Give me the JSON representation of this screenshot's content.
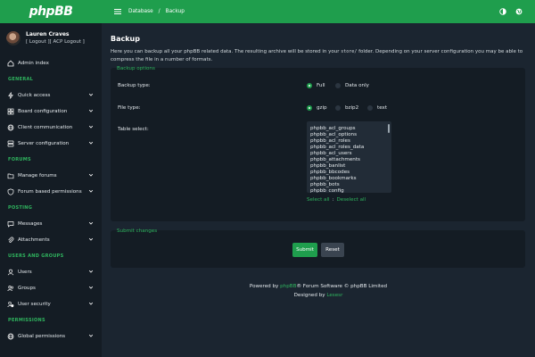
{
  "app": {
    "logo": "phpBB"
  },
  "user": {
    "name": "Lauren Craves",
    "links": "[ Logout ][ ACP Logout ]"
  },
  "sidebar": {
    "items": [
      {
        "type": "item",
        "label": "Admin index",
        "icon": "home-icon",
        "chevron": false
      },
      {
        "type": "section",
        "label": "GENERAL"
      },
      {
        "type": "item",
        "label": "Quick access",
        "icon": "bolt-icon",
        "chevron": true
      },
      {
        "type": "item",
        "label": "Board configuration",
        "icon": "grid-icon",
        "chevron": true
      },
      {
        "type": "item",
        "label": "Client communication",
        "icon": "globe-icon",
        "chevron": true
      },
      {
        "type": "item",
        "label": "Server configuration",
        "icon": "server-icon",
        "chevron": true
      },
      {
        "type": "section",
        "label": "FORUMS"
      },
      {
        "type": "item",
        "label": "Manage forums",
        "icon": "folder-icon",
        "chevron": true
      },
      {
        "type": "item",
        "label": "Forum based permissions",
        "icon": "shield-icon",
        "chevron": true
      },
      {
        "type": "section",
        "label": "POSTING"
      },
      {
        "type": "item",
        "label": "Messages",
        "icon": "chat-icon",
        "chevron": true
      },
      {
        "type": "item",
        "label": "Attachments",
        "icon": "paperclip-icon",
        "chevron": true
      },
      {
        "type": "section",
        "label": "USERS AND GROUPS"
      },
      {
        "type": "item",
        "label": "Users",
        "icon": "user-icon",
        "chevron": true
      },
      {
        "type": "item",
        "label": "Groups",
        "icon": "users-icon",
        "chevron": true
      },
      {
        "type": "item",
        "label": "User security",
        "icon": "user-shield-icon",
        "chevron": true
      },
      {
        "type": "section",
        "label": "PERMISSIONS"
      },
      {
        "type": "item",
        "label": "Global permissions",
        "icon": "globe-icon",
        "chevron": true
      }
    ]
  },
  "topbar": {
    "breadcrumb": [
      "Database",
      "Backup"
    ],
    "icons": [
      "theme-toggle-icon",
      "language-icon"
    ]
  },
  "page": {
    "title": "Backup",
    "intro_before": "Here you can backup all your phpBB related data. The resulting archive will be stored in your ",
    "intro_code": "store/",
    "intro_after": " folder. Depending on your server configuration you may be able to compress the file in a number of formats."
  },
  "backup_options": {
    "legend": "Backup options",
    "backup_type": {
      "label": "Backup type:",
      "options": [
        "Full",
        "Data only"
      ],
      "selected": "Full"
    },
    "file_type": {
      "label": "File type:",
      "options": [
        "gzip",
        "bzip2",
        "text"
      ],
      "selected": "gzip"
    },
    "table_select": {
      "label": "Table select:",
      "tables": [
        "phpbb_acl_groups",
        "phpbb_acl_options",
        "phpbb_acl_roles",
        "phpbb_acl_roles_data",
        "phpbb_acl_users",
        "phpbb_attachments",
        "phpbb_banlist",
        "phpbb_bbcodes",
        "phpbb_bookmarks",
        "phpbb_bots",
        "phpbb_config"
      ]
    },
    "select_all": "Select all",
    "separator": ":",
    "deselect_all": "Deselect all"
  },
  "submit_changes": {
    "legend": "Submit changes",
    "submit": "Submit",
    "reset": "Reset"
  },
  "footer": {
    "powered_prefix": "Powered by ",
    "phpbb_link": "phpBB",
    "powered_suffix": "® Forum Software © phpBB Limited",
    "designed_prefix": "Designed by ",
    "designer": "Lesesr"
  },
  "colors": {
    "accent": "#1f9e4d",
    "sidebar": "#141c24",
    "background": "#1b2530",
    "panel": "#141c24"
  }
}
